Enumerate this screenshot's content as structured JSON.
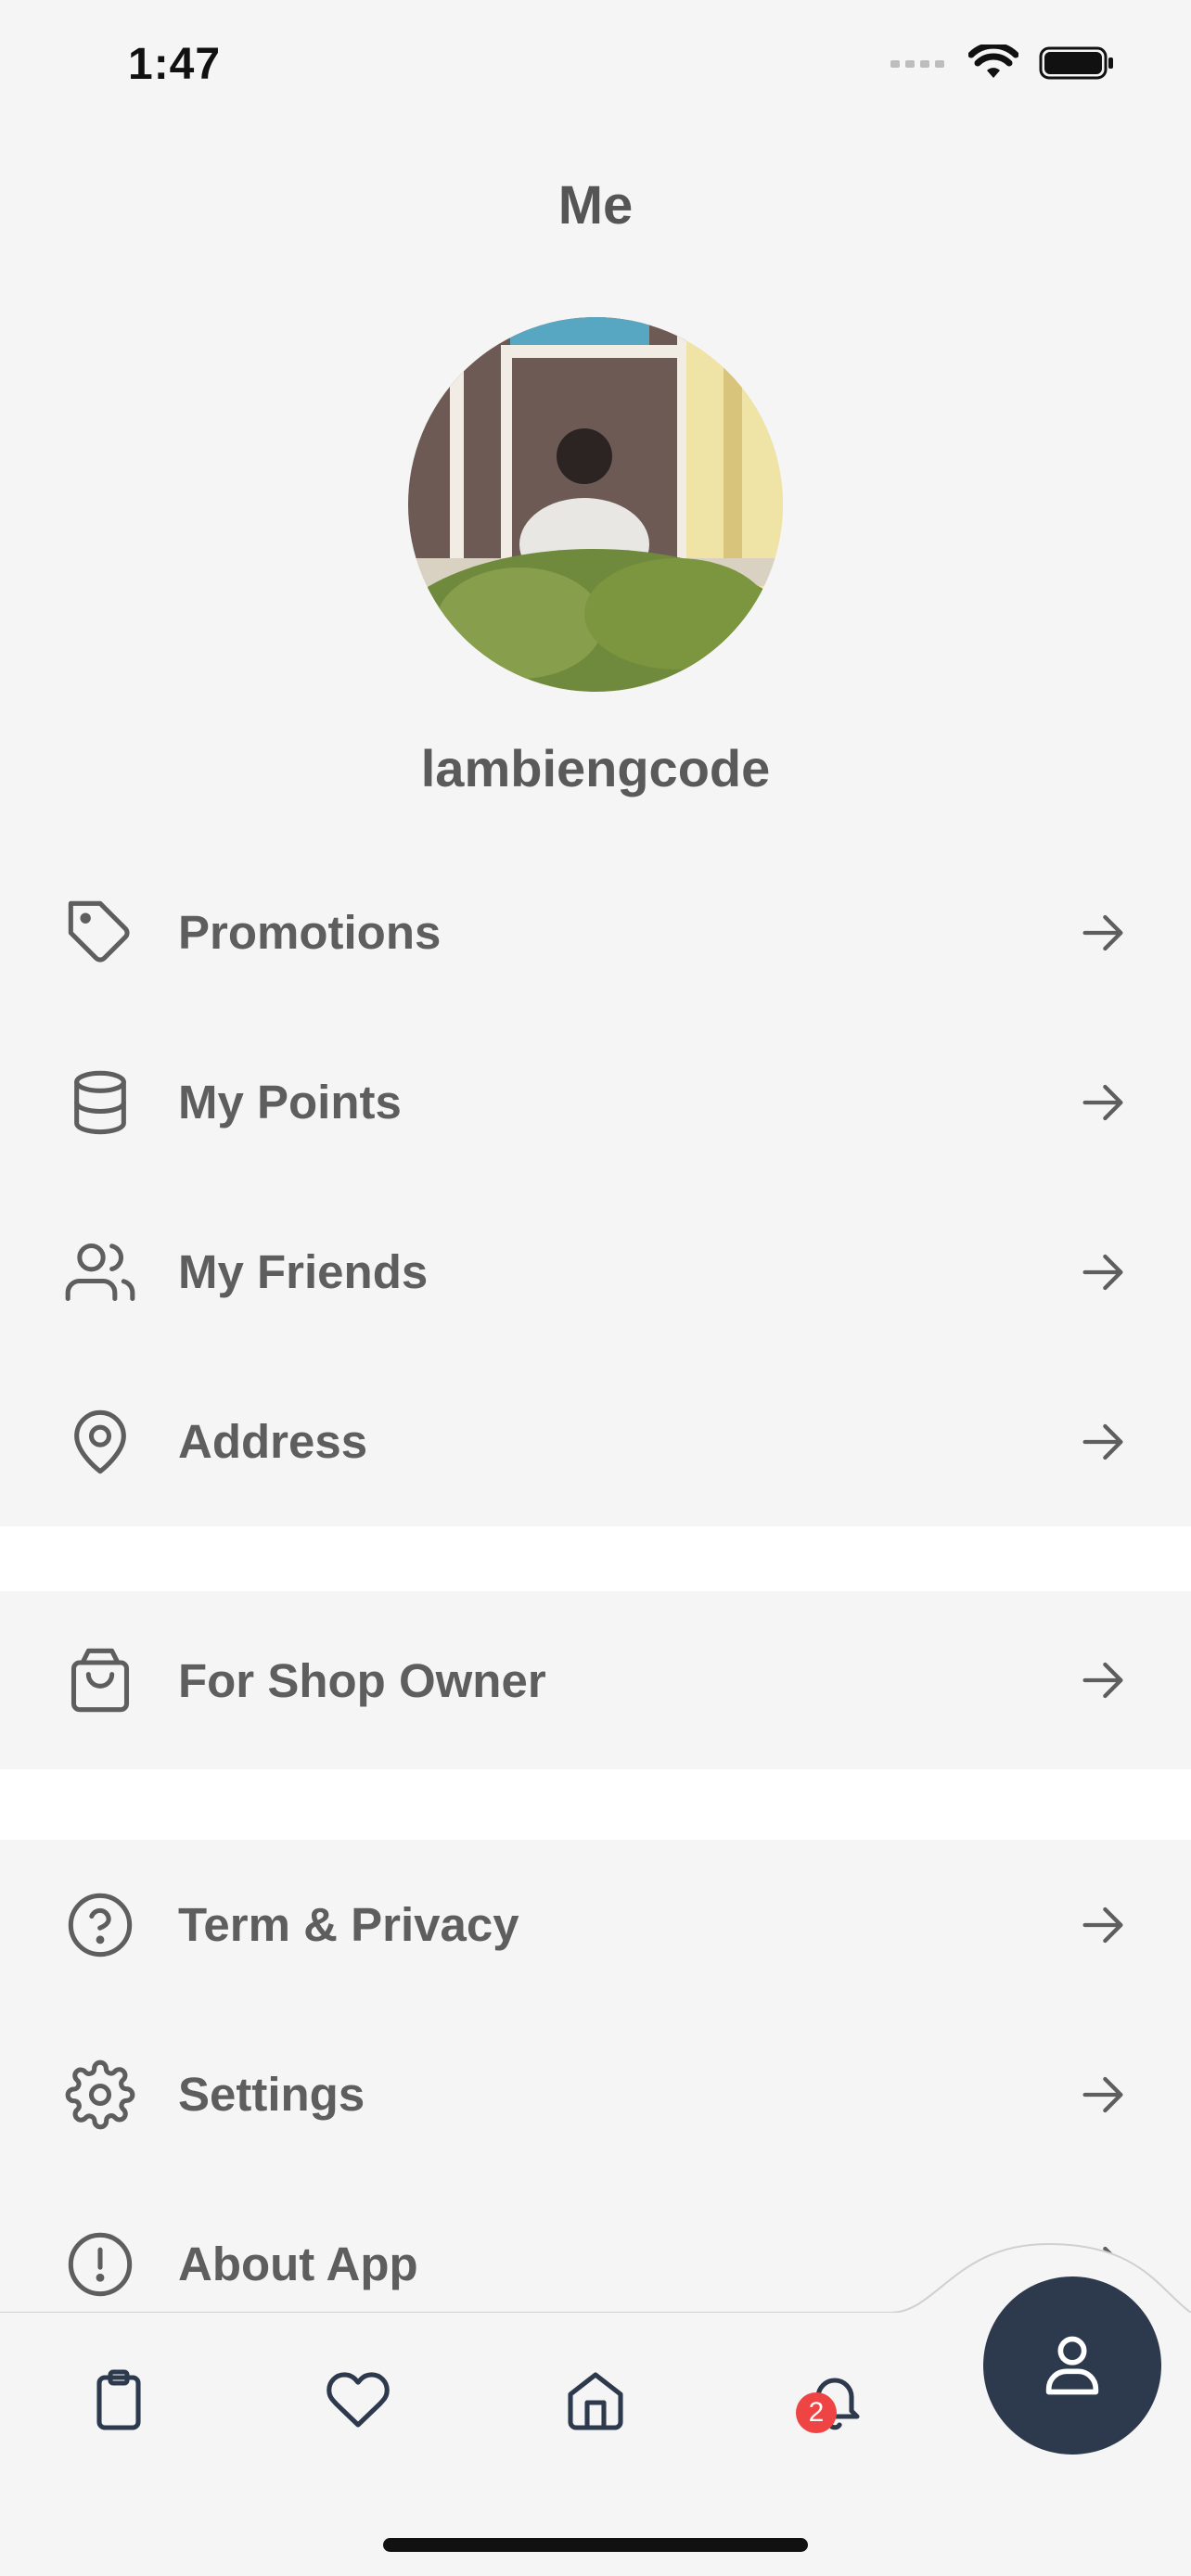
{
  "status": {
    "time": "1:47"
  },
  "header": {
    "title": "Me"
  },
  "profile": {
    "username": "lambiengcode"
  },
  "menu_groups": [
    {
      "items": [
        {
          "label": "Promotions",
          "icon": "tag-icon"
        },
        {
          "label": "My Points",
          "icon": "database-icon"
        },
        {
          "label": "My Friends",
          "icon": "users-icon"
        },
        {
          "label": "Address",
          "icon": "map-pin-icon"
        }
      ]
    },
    {
      "items": [
        {
          "label": "For Shop Owner",
          "icon": "shopping-bag-icon"
        }
      ]
    },
    {
      "items": [
        {
          "label": "Term & Privacy",
          "icon": "help-circle-icon"
        },
        {
          "label": "Settings",
          "icon": "gear-icon"
        },
        {
          "label": "About App",
          "icon": "alert-circle-icon"
        }
      ]
    }
  ],
  "tabs": [
    {
      "name": "orders",
      "icon": "clipboard-icon"
    },
    {
      "name": "favorites",
      "icon": "heart-icon"
    },
    {
      "name": "home",
      "icon": "home-icon"
    },
    {
      "name": "notifications",
      "icon": "bell-icon",
      "badge": "2"
    },
    {
      "name": "profile",
      "icon": "user-icon",
      "active": true
    }
  ],
  "colors": {
    "background": "#f5f5f5",
    "text": "#5e5e5e",
    "fab": "#2d3a4d",
    "badge": "#ef4444"
  }
}
